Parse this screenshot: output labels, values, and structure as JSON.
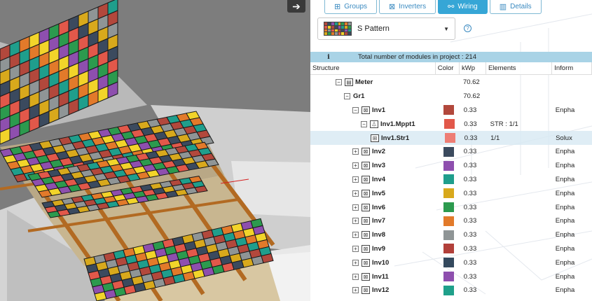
{
  "nav": {
    "arrow_icon": "arrow-right-icon"
  },
  "tabs": [
    {
      "label": "Groups",
      "icon": "groups-icon",
      "active": false
    },
    {
      "label": "Inverters",
      "icon": "inverter-icon",
      "active": false
    },
    {
      "label": "Wiring",
      "icon": "wiring-icon",
      "active": true
    },
    {
      "label": "Details",
      "icon": "chart-icon",
      "active": false
    }
  ],
  "pattern": {
    "selected": "S Pattern"
  },
  "info": {
    "text": "Total number of modules in project : 214"
  },
  "table": {
    "headers": {
      "structure": "Structure",
      "color": "Color",
      "kwp": "kWp",
      "elements": "Elements",
      "info": "Inform"
    },
    "rows": [
      {
        "level": 1,
        "expander": "⊟",
        "icon": "meter-icon",
        "name": "Meter",
        "color": "",
        "kwp": "70.62",
        "elements": "",
        "info": ""
      },
      {
        "level": 2,
        "expander": "⊟",
        "icon": "",
        "name": "Gr1",
        "color": "",
        "kwp": "70.62",
        "elements": "",
        "info": ""
      },
      {
        "level": 3,
        "expander": "⊟",
        "icon": "inverter-icon",
        "name": "Inv1",
        "color": "#b2483c",
        "kwp": "0.33",
        "elements": "",
        "info": "Enpha"
      },
      {
        "level": 4,
        "expander": "⊟",
        "icon": "mppt-icon",
        "name": "Inv1.Mppt1",
        "color": "#e2584a",
        "kwp": "0.33",
        "elements": "STR : 1/1",
        "info": ""
      },
      {
        "level": 5,
        "expander": "",
        "icon": "string-icon",
        "name": "Inv1.Str1",
        "color": "#ee7d74",
        "kwp": "0.33",
        "elements": "1/1",
        "info": "Solux",
        "selected": true
      },
      {
        "level": 3,
        "expander": "⊞",
        "icon": "inverter-icon",
        "name": "Inv2",
        "color": "#3b4a5e",
        "kwp": "0.33",
        "elements": "",
        "info": "Enpha"
      },
      {
        "level": 3,
        "expander": "⊞",
        "icon": "inverter-icon",
        "name": "Inv3",
        "color": "#8e4fae",
        "kwp": "0.33",
        "elements": "",
        "info": "Enpha"
      },
      {
        "level": 3,
        "expander": "⊞",
        "icon": "inverter-icon",
        "name": "Inv4",
        "color": "#1f9e8c",
        "kwp": "0.33",
        "elements": "",
        "info": "Enpha"
      },
      {
        "level": 3,
        "expander": "⊞",
        "icon": "inverter-icon",
        "name": "Inv5",
        "color": "#d8a91c",
        "kwp": "0.33",
        "elements": "",
        "info": "Enpha"
      },
      {
        "level": 3,
        "expander": "⊞",
        "icon": "inverter-icon",
        "name": "Inv6",
        "color": "#2c9a4e",
        "kwp": "0.33",
        "elements": "",
        "info": "Enpha"
      },
      {
        "level": 3,
        "expander": "⊞",
        "icon": "inverter-icon",
        "name": "Inv7",
        "color": "#e27a2a",
        "kwp": "0.33",
        "elements": "",
        "info": "Enpha"
      },
      {
        "level": 3,
        "expander": "⊞",
        "icon": "inverter-icon",
        "name": "Inv8",
        "color": "#8f9596",
        "kwp": "0.33",
        "elements": "",
        "info": "Enpha"
      },
      {
        "level": 3,
        "expander": "⊞",
        "icon": "inverter-icon",
        "name": "Inv9",
        "color": "#b2403a",
        "kwp": "0.33",
        "elements": "",
        "info": "Enpha"
      },
      {
        "level": 3,
        "expander": "⊞",
        "icon": "inverter-icon",
        "name": "Inv10",
        "color": "#34495e",
        "kwp": "0.33",
        "elements": "",
        "info": "Enpha"
      },
      {
        "level": 3,
        "expander": "⊞",
        "icon": "inverter-icon",
        "name": "Inv11",
        "color": "#8e4fae",
        "kwp": "0.33",
        "elements": "",
        "info": "Enpha"
      },
      {
        "level": 3,
        "expander": "⊞",
        "icon": "inverter-icon",
        "name": "Inv12",
        "color": "#1fa08a",
        "kwp": "0.33",
        "elements": "",
        "info": "Enpha"
      }
    ]
  },
  "colors": {
    "accent": "#36a6d6",
    "info_bar": "#a9d3e6",
    "module_palette": [
      "#b2483c",
      "#3b4a5e",
      "#8e4fae",
      "#1f9e8c",
      "#d8a91c",
      "#2c9a4e",
      "#e27a2a",
      "#8f9596",
      "#e2584a",
      "#f2d42a"
    ]
  }
}
